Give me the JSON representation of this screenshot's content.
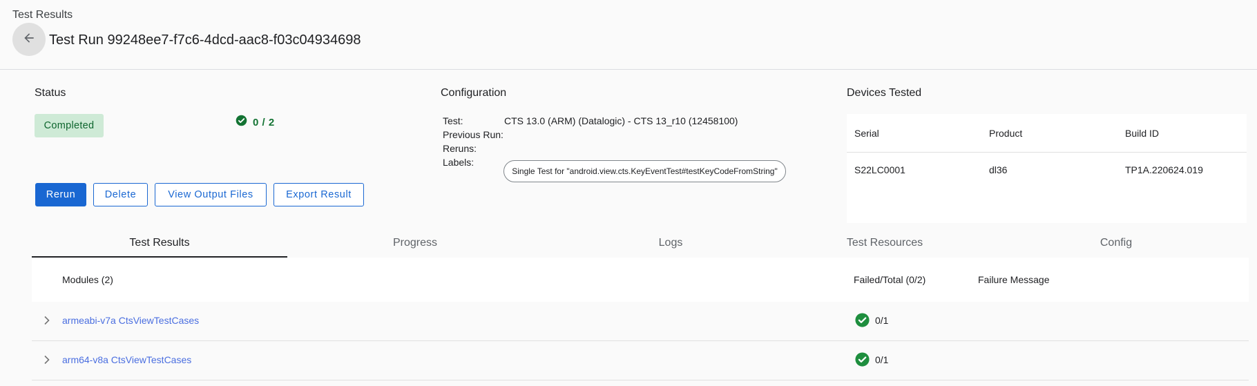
{
  "header": {
    "breadcrumb": "Test Results",
    "back_icon": "arrow-left-icon",
    "title": "Test Run 99248ee7-f7c6-4dcd-aac8-f03c04934698"
  },
  "status": {
    "section_title": "Status",
    "badge": "Completed",
    "summary": "0 / 2",
    "summary_icon": "check-circle-icon",
    "badge_bg": "#ceead6",
    "badge_fg": "#0d652d"
  },
  "actions": {
    "rerun": "Rerun",
    "delete": "Delete",
    "view_output": "View Output Files",
    "export": "Export Result"
  },
  "configuration": {
    "section_title": "Configuration",
    "test_label": "Test:",
    "test_value": "CTS 13.0 (ARM) (Datalogic) - CTS 13_r10 (12458100)",
    "previous_run_label": "Previous Run:",
    "reruns_label": "Reruns:",
    "labels_label": "Labels:",
    "label_chip": "Single Test for \"android.view.cts.KeyEventTest#testKeyCodeFromString\""
  },
  "devices": {
    "section_title": "Devices Tested",
    "columns": [
      "Serial",
      "Product",
      "Build ID"
    ],
    "rows": [
      {
        "serial": "S22LC0001",
        "product": "dl36",
        "build_id": "TP1A.220624.019"
      }
    ]
  },
  "tabs": [
    {
      "label": "Test Results",
      "active": true
    },
    {
      "label": "Progress",
      "active": false
    },
    {
      "label": "Logs",
      "active": false
    },
    {
      "label": "Test Resources",
      "active": false
    },
    {
      "label": "Config",
      "active": false
    }
  ],
  "modules": {
    "header_modules": "Modules (2)",
    "header_failed_total": "Failed/Total (0/2)",
    "header_failure_message": "Failure Message",
    "rows": [
      {
        "name": "armeabi-v7a CtsViewTestCases",
        "count": "0/1",
        "icon": "check-circle-icon"
      },
      {
        "name": "arm64-v8a CtsViewTestCases",
        "count": "0/1",
        "icon": "check-circle-icon"
      }
    ]
  },
  "colors": {
    "accent": "#1967d2",
    "pass": "#1e8e3e",
    "link": "#4a6ee0"
  }
}
